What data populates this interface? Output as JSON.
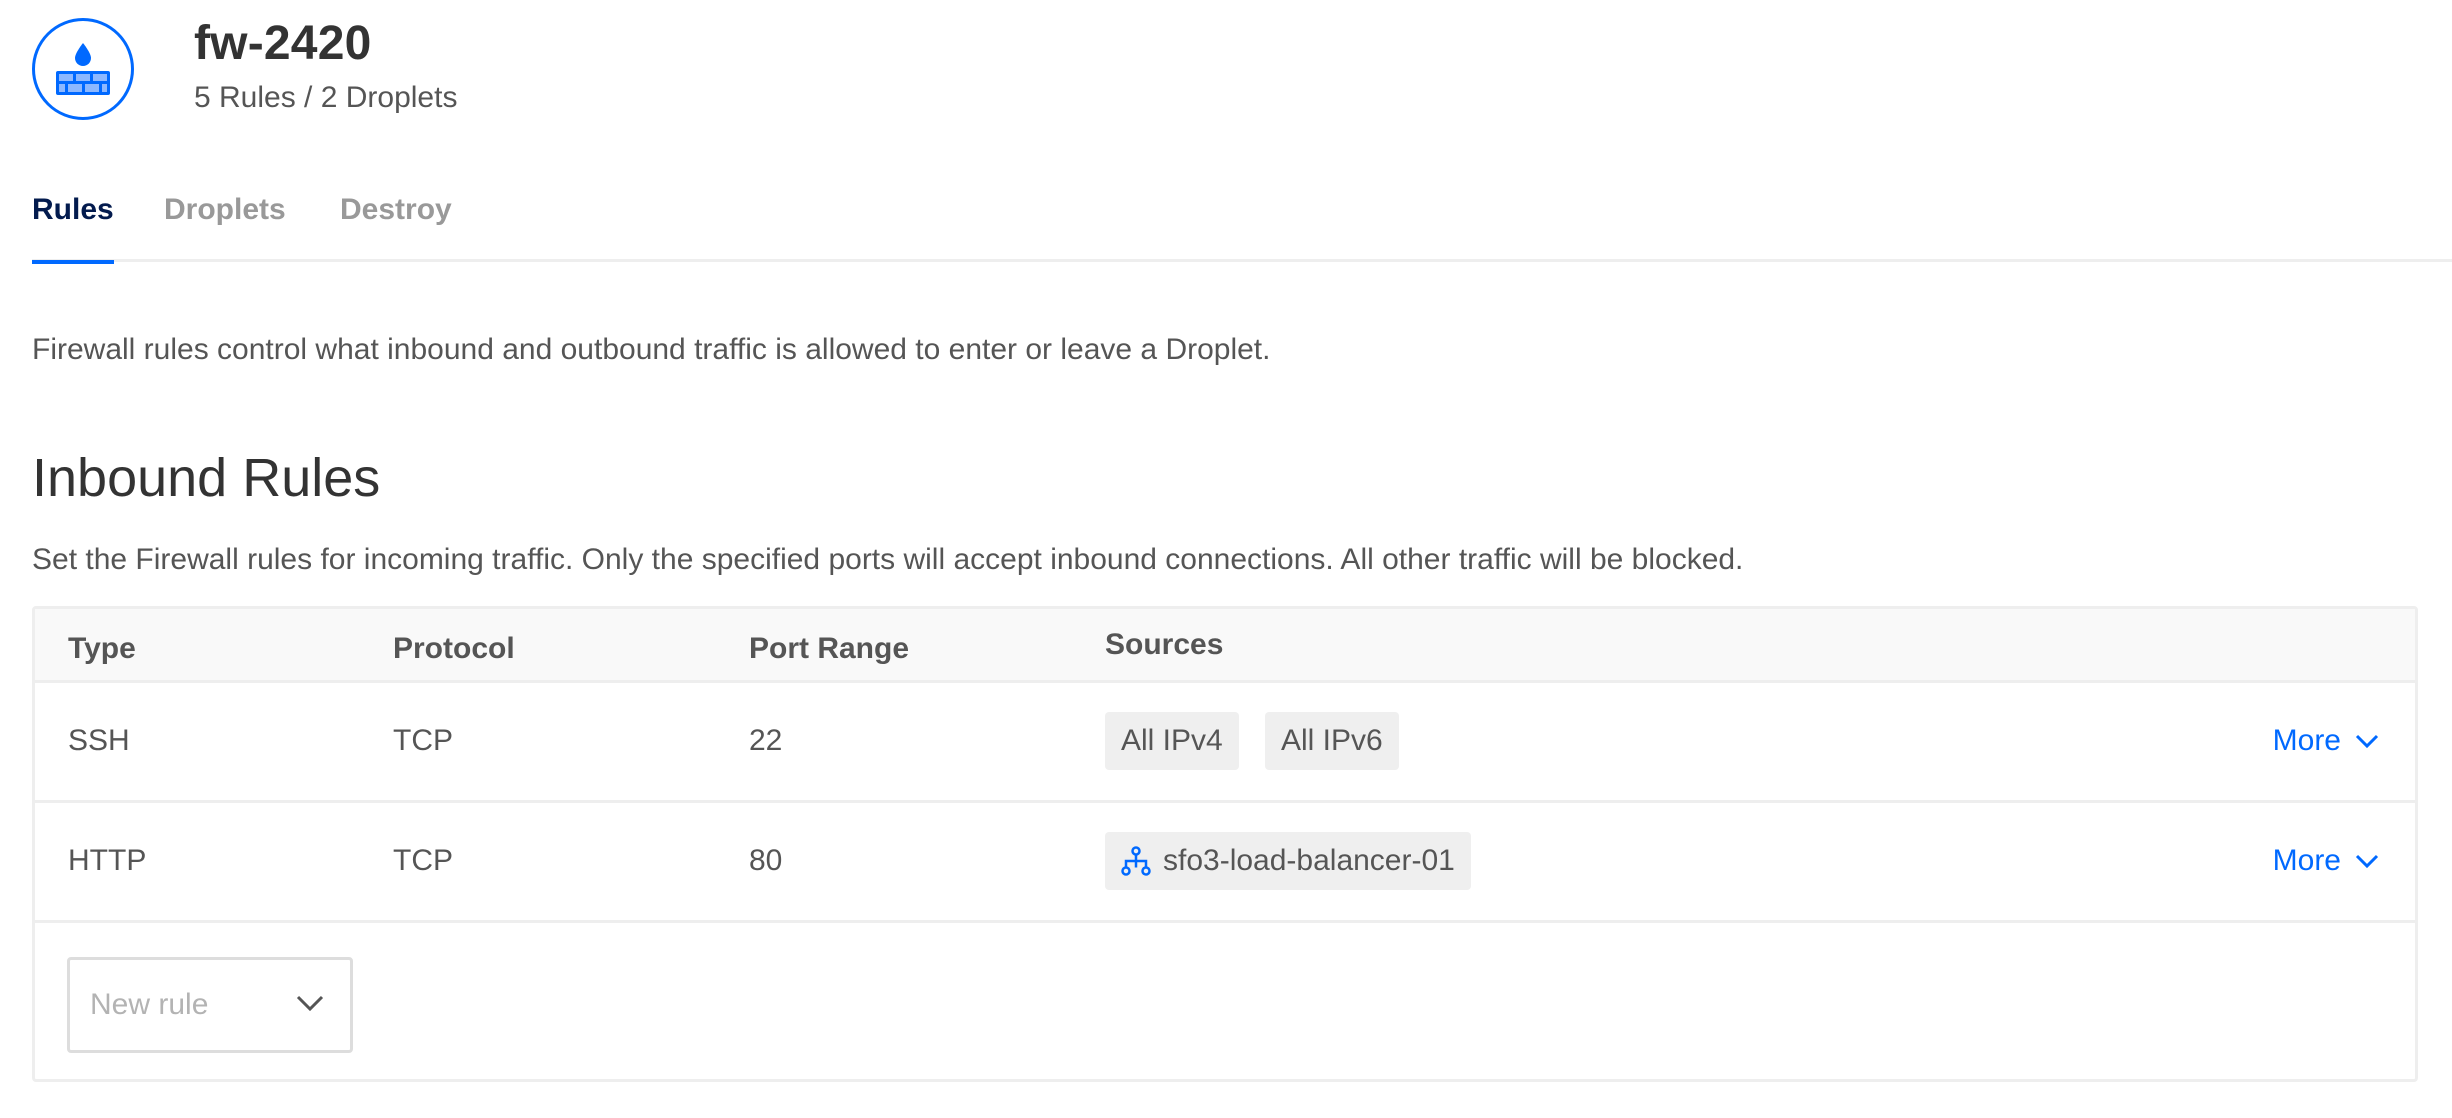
{
  "header": {
    "title": "fw-2420",
    "subtitle": "5 Rules / 2 Droplets",
    "icon": "firewall-icon"
  },
  "tabs": [
    {
      "label": "Rules",
      "active": true
    },
    {
      "label": "Droplets",
      "active": false
    },
    {
      "label": "Destroy",
      "active": false
    }
  ],
  "intro": "Firewall rules control what inbound and outbound traffic is allowed to enter or leave a Droplet.",
  "inbound": {
    "title": "Inbound Rules",
    "description": "Set the Firewall rules for incoming traffic. Only the specified ports will accept inbound connections. All other traffic will be blocked.",
    "columns": [
      "Type",
      "Protocol",
      "Port Range",
      "Sources"
    ],
    "rows": [
      {
        "type": "SSH",
        "protocol": "TCP",
        "port_range": "22",
        "sources": [
          "All IPv4",
          "All IPv6"
        ],
        "more_label": "More"
      },
      {
        "type": "HTTP",
        "protocol": "TCP",
        "port_range": "80",
        "sources": [
          "sfo3-load-balancer-01"
        ],
        "source_icon": "load-balancer-icon",
        "more_label": "More"
      }
    ],
    "new_rule_placeholder": "New rule"
  },
  "colors": {
    "accent": "#0069ff",
    "tab_active": "#031b4e",
    "text": "#555555",
    "muted": "#999999",
    "chip_bg": "#efefef",
    "border": "#eeeeee"
  }
}
